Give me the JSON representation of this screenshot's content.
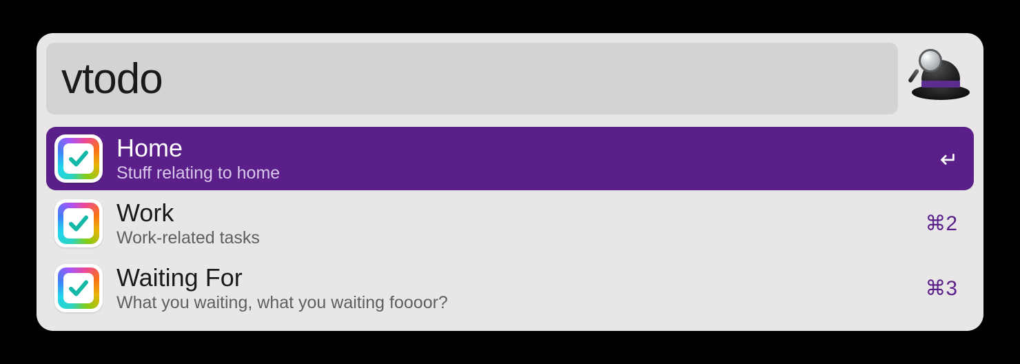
{
  "search": {
    "value": "vtodo",
    "placeholder": ""
  },
  "results": [
    {
      "title": "Home",
      "subtitle": "Stuff relating to home",
      "shortcut": "↩",
      "shortcut_type": "return",
      "selected": true
    },
    {
      "title": "Work",
      "subtitle": "Work-related tasks",
      "shortcut": "⌘2",
      "shortcut_type": "text",
      "selected": false
    },
    {
      "title": "Waiting For",
      "subtitle": "What you waiting, what you waiting foooor?",
      "shortcut": "⌘3",
      "shortcut_type": "text",
      "selected": false
    }
  ],
  "colors": {
    "selection": "#5a1f88",
    "panel_bg": "#e8e6e6",
    "search_bg": "#d4d2d2"
  }
}
